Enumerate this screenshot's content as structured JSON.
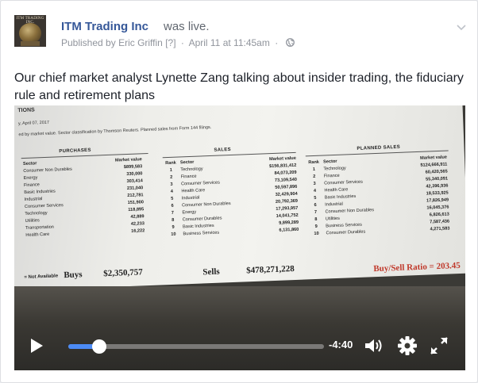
{
  "post": {
    "avatar_label": "ITM TRADING INC.",
    "page_name": "ITM Trading Inc",
    "status": "was live.",
    "published_by_prefix": "Published by",
    "author": "Eric Griffin",
    "help_marker": "[?]",
    "separator": "·",
    "date": "April 11 at 11:45am",
    "privacy_icon": "globe-icon",
    "menu_icon": "chevron-down-icon",
    "text": "Our chief market analyst Lynette Zang talking about insider trading, the fiduciary rule and retirement plans"
  },
  "document": {
    "top_label": "TIONS",
    "date_line": "y, April 07, 2017",
    "subtitle": "ed by market value. Sector classification by Thomson Reuters. Planned sales from Form 144 filings.",
    "purchases_heading": "PURCHASES",
    "sales_heading": "SALES",
    "planned_heading": "PLANNED SALES",
    "col_sector": "Sector",
    "col_rank": "Rank",
    "col_market_value": "Market value",
    "purchases": [
      {
        "sector": "Consumer Non Durables",
        "value": "$899,583"
      },
      {
        "sector": "Energy",
        "value": "330,000"
      },
      {
        "sector": "Finance",
        "value": "303,414"
      },
      {
        "sector": "Basic Industries",
        "value": "231,040"
      },
      {
        "sector": "Industrial",
        "value": "212,781"
      },
      {
        "sector": "Consumer Services",
        "value": "151,900"
      },
      {
        "sector": "Technology",
        "value": "118,895"
      },
      {
        "sector": "Utilities",
        "value": "42,889"
      },
      {
        "sector": "Transportation",
        "value": "42,233"
      },
      {
        "sector": "Health Care",
        "value": "16,222"
      }
    ],
    "sales": [
      {
        "rank": "1",
        "sector": "Technology",
        "value": "$156,831,412"
      },
      {
        "rank": "2",
        "sector": "Finance",
        "value": "84,073,209"
      },
      {
        "rank": "3",
        "sector": "Consumer Services",
        "value": "73,109,540"
      },
      {
        "rank": "4",
        "sector": "Health Care",
        "value": "50,597,896"
      },
      {
        "rank": "5",
        "sector": "Industrial",
        "value": "32,429,904"
      },
      {
        "rank": "6",
        "sector": "Consumer Non Durables",
        "value": "20,792,369"
      },
      {
        "rank": "7",
        "sector": "Energy",
        "value": "17,293,957"
      },
      {
        "rank": "8",
        "sector": "Consumer Durables",
        "value": "14,041,752"
      },
      {
        "rank": "9",
        "sector": "Basic Industries",
        "value": "9,899,289"
      },
      {
        "rank": "10",
        "sector": "Business Services",
        "value": "6,131,860"
      }
    ],
    "planned": [
      {
        "rank": "1",
        "sector": "Technology",
        "value": "$124,666,911"
      },
      {
        "rank": "2",
        "sector": "Finance",
        "value": "60,420,565"
      },
      {
        "rank": "3",
        "sector": "Consumer Services",
        "value": "55,340,091"
      },
      {
        "rank": "4",
        "sector": "Health Care",
        "value": "42,396,936"
      },
      {
        "rank": "5",
        "sector": "Basic Industries",
        "value": "18,533,925"
      },
      {
        "rank": "6",
        "sector": "Industrial",
        "value": "17,826,949"
      },
      {
        "rank": "7",
        "sector": "Consumer Non Durables",
        "value": "16,045,376"
      },
      {
        "rank": "8",
        "sector": "Utilities",
        "value": "6,826,613"
      },
      {
        "rank": "9",
        "sector": "Business Services",
        "value": "7,587,436"
      },
      {
        "rank": "10",
        "sector": "Consumer Durables",
        "value": "4,271,583"
      }
    ],
    "summary": {
      "na_label": "= Not Available",
      "buys_label": "Buys",
      "buys_value": "$2,350,757",
      "sells_label": "Sells",
      "sells_value": "$478,271,228",
      "ratio_label": "Buy/Sell Ratio = 203.45"
    }
  },
  "player": {
    "time_remaining": "-4:40",
    "progress_fraction": 0.12,
    "colors": {
      "progress": "#4c8bf5",
      "handle": "#ffffff"
    },
    "icons": {
      "play": "play-icon",
      "volume": "volume-icon",
      "settings": "gear-icon",
      "fullscreen": "fullscreen-icon"
    }
  }
}
